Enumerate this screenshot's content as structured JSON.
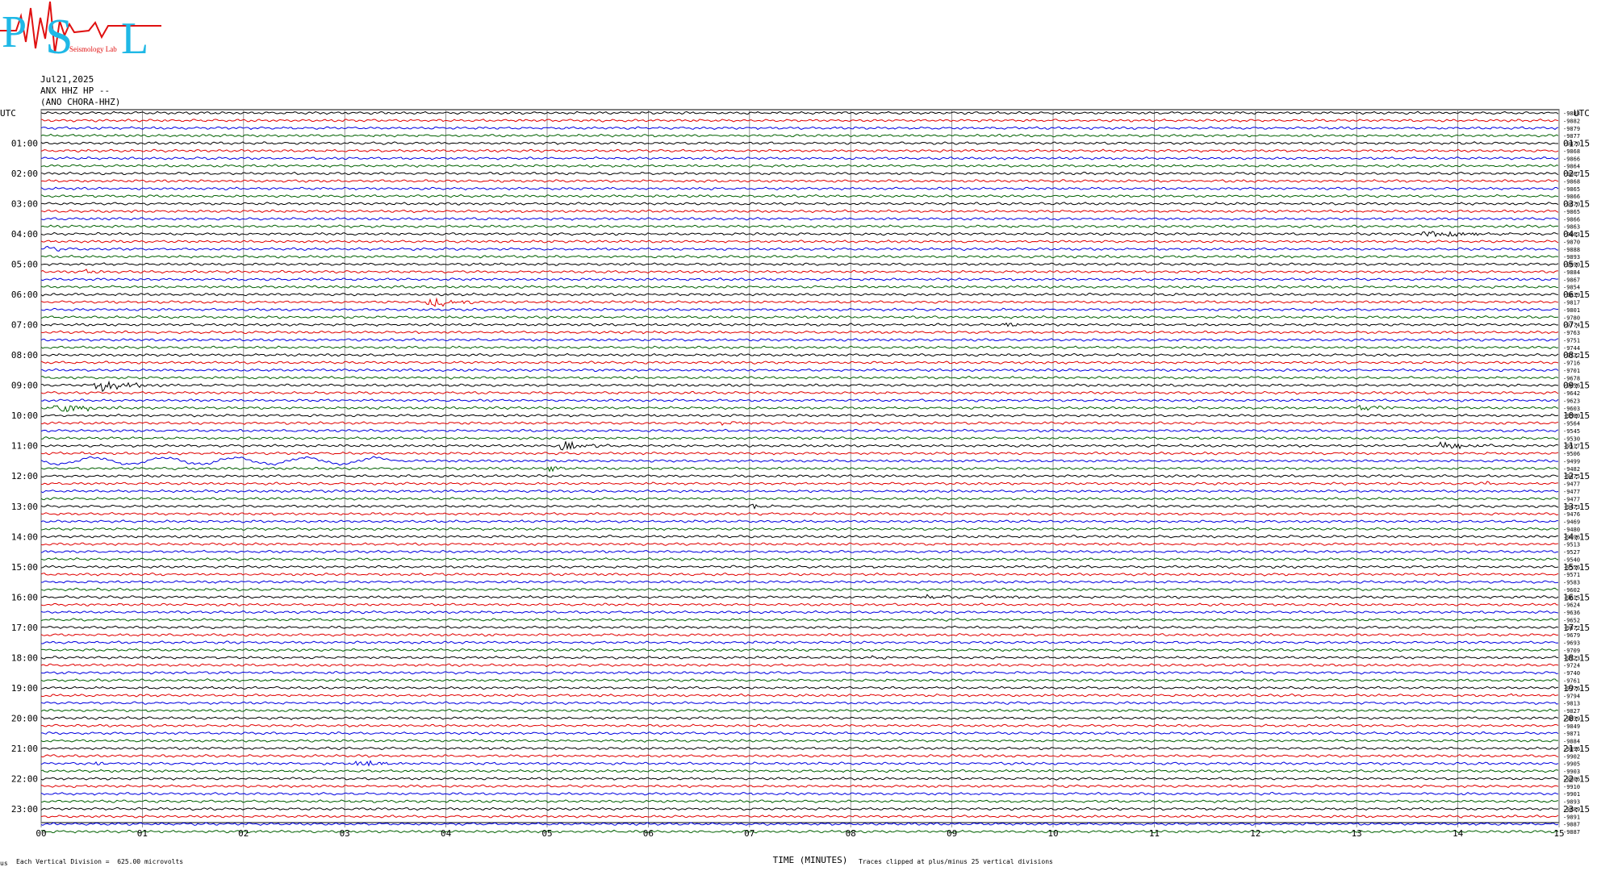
{
  "logo": {
    "letters": [
      "P",
      "S",
      "L"
    ],
    "subtext": "Seismology Lab",
    "colors": {
      "cyan": "#1fb8e6",
      "red": "#e01010"
    }
  },
  "header": {
    "date": "Jul21,2025",
    "station": "ANX HHZ HP --",
    "reference": "(ANO CHORA-HHZ)"
  },
  "footer": {
    "left_mark": "us",
    "division": "Each Vertical Division =  625.00 microvolts",
    "xlabel": "TIME (MINUTES)",
    "clip_note": "Traces clipped at plus/minus 25 vertical divisions"
  },
  "chart_data": {
    "type": "line",
    "title": "",
    "xlabel": "TIME (MINUTES)",
    "ylabel": "UTC",
    "xlim": [
      0,
      15
    ],
    "x_ticks": [
      "00",
      "01",
      "02",
      "03",
      "04",
      "05",
      "06",
      "07",
      "08",
      "09",
      "10",
      "11",
      "12",
      "13",
      "14",
      "15"
    ],
    "left_axis_label": "UTC",
    "right_axis_label": "UTC",
    "row_count": 96,
    "row_minutes": 15,
    "color_cycle": [
      "#000000",
      "#e00000",
      "#0000e0",
      "#006000"
    ],
    "left_time_labels": [
      "01:00",
      "02:00",
      "03:00",
      "04:00",
      "05:00",
      "06:00",
      "07:00",
      "08:00",
      "09:00",
      "10:00",
      "11:00",
      "12:00",
      "13:00",
      "14:00",
      "15:00",
      "16:00",
      "17:00",
      "18:00",
      "19:00",
      "20:00",
      "21:00",
      "22:00",
      "23:00"
    ],
    "right_time_labels": [
      "01:15",
      "02:15",
      "03:15",
      "04:15",
      "05:15",
      "06:15",
      "07:15",
      "08:15",
      "09:15",
      "10:15",
      "11:15",
      "12:15",
      "13:15",
      "14:15",
      "15:15",
      "16:15",
      "17:15",
      "18:15",
      "19:15",
      "20:15",
      "21:15",
      "22:15",
      "23:15"
    ],
    "row_values": [
      "-9883",
      "-9882",
      "-9879",
      "-9877",
      "-9870",
      "-9868",
      "-9866",
      "-9864",
      "-9867",
      "-9868",
      "-9865",
      "-9866",
      "-9870",
      "-9865",
      "-9866",
      "-9863",
      "-9863",
      "-9870",
      "-9888",
      "-9893",
      "-9890",
      "-9884",
      "-9867",
      "-9854",
      "-9839",
      "-9817",
      "-9801",
      "-9780",
      "-9774",
      "-9763",
      "-9751",
      "-9744",
      "-9732",
      "-9716",
      "-9701",
      "-9678",
      "-9656",
      "-9642",
      "-9623",
      "-9603",
      "-9580",
      "-9564",
      "-9545",
      "-9530",
      "-9517",
      "-9506",
      "-9499",
      "-9482",
      "-9475",
      "-9477",
      "-9477",
      "-9477",
      "-9473",
      "-9476",
      "-9469",
      "-9480",
      "-9496",
      "-9513",
      "-9527",
      "-9540",
      "-9556",
      "-9571",
      "-9583",
      "-9602",
      "-9615",
      "-9624",
      "-9636",
      "-9652",
      "-9672",
      "-9679",
      "-9693",
      "-9709",
      "-9723",
      "-9724",
      "-9740",
      "-9761",
      "-9776",
      "-9794",
      "-9813",
      "-9827",
      "-9839",
      "-9849",
      "-9871",
      "-9884",
      "-9896",
      "-9902",
      "-9905",
      "-9903",
      "-9906",
      "-9910",
      "-9901",
      "-9893",
      "-9889",
      "-9891",
      "-9887",
      "-9887"
    ],
    "events": [
      {
        "row": 16,
        "start": 13.6,
        "end": 14.8,
        "amp": 6
      },
      {
        "row": 18,
        "start": 0.0,
        "end": 0.4,
        "amp": 5
      },
      {
        "row": 21,
        "start": 0.4,
        "end": 0.8,
        "amp": 3
      },
      {
        "row": 25,
        "start": 3.8,
        "end": 4.5,
        "amp": 9
      },
      {
        "row": 28,
        "start": 9.5,
        "end": 9.9,
        "amp": 3
      },
      {
        "row": 29,
        "start": 5.8,
        "end": 6.1,
        "amp": 3
      },
      {
        "row": 36,
        "start": 0.5,
        "end": 1.3,
        "amp": 10
      },
      {
        "row": 39,
        "start": 0.1,
        "end": 1.0,
        "amp": 7
      },
      {
        "row": 39,
        "start": 13.0,
        "end": 13.5,
        "amp": 6
      },
      {
        "row": 41,
        "start": 6.7,
        "end": 7.4,
        "amp": 4
      },
      {
        "row": 44,
        "start": 5.1,
        "end": 5.7,
        "amp": 8
      },
      {
        "row": 44,
        "start": 13.8,
        "end": 14.4,
        "amp": 8
      },
      {
        "row": 47,
        "start": 5.0,
        "end": 5.3,
        "amp": 4
      },
      {
        "row": 49,
        "start": 14.2,
        "end": 14.6,
        "amp": 4
      },
      {
        "row": 52,
        "start": 7.0,
        "end": 7.3,
        "amp": 4
      },
      {
        "row": 64,
        "start": 8.5,
        "end": 10.8,
        "amp": 3
      },
      {
        "row": 68,
        "start": 10.7,
        "end": 11.0,
        "amp": 3
      },
      {
        "row": 72,
        "start": 8.2,
        "end": 8.5,
        "amp": 3
      },
      {
        "row": 77,
        "start": 14.5,
        "end": 14.8,
        "amp": 4
      },
      {
        "row": 86,
        "start": 0.5,
        "end": 0.9,
        "amp": 3
      },
      {
        "row": 86,
        "start": 3.1,
        "end": 3.6,
        "amp": 7
      }
    ],
    "long_period": {
      "row": 46,
      "start": 0.0,
      "end": 3.5,
      "amp": 5
    }
  }
}
